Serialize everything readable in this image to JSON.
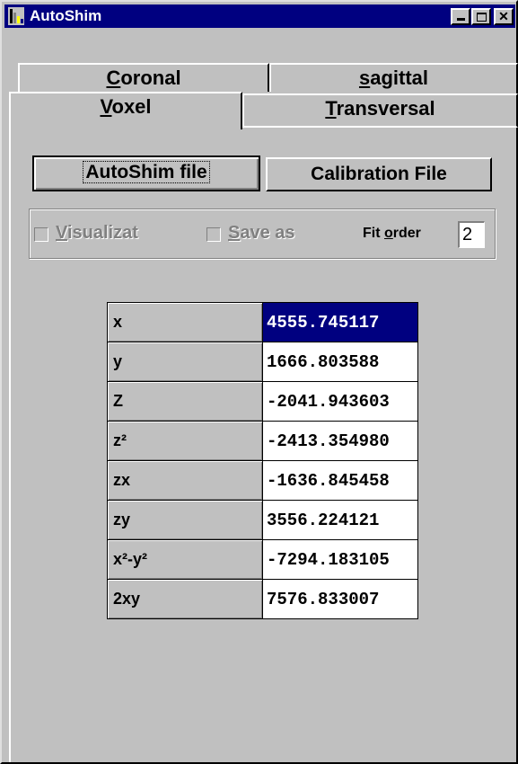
{
  "window": {
    "title": "AutoShim"
  },
  "tabs": {
    "row_back": [
      {
        "label_pre": "",
        "label_u": "C",
        "label_post": "oronal"
      },
      {
        "label_pre": "",
        "label_u": "s",
        "label_post": "agittal"
      }
    ],
    "row_front": [
      {
        "label_pre": "",
        "label_u": "V",
        "label_post": "oxel"
      },
      {
        "label_pre": "",
        "label_u": "T",
        "label_post": "ransversal"
      }
    ]
  },
  "buttons": {
    "autoshim_file": "AutoShim file",
    "calibration_file": "Calibration File"
  },
  "options": {
    "visualize_label_u": "V",
    "visualize_label_rest": "isualizat",
    "save_label_u": "S",
    "save_label_rest": "ave as",
    "fit_order_pre": "Fit ",
    "fit_order_u": "o",
    "fit_order_post": "rder",
    "fit_order_value": "2"
  },
  "grid": {
    "rows": [
      {
        "label": "x",
        "value": "4555.745117"
      },
      {
        "label": "y",
        "value": "1666.803588"
      },
      {
        "label": "Z",
        "value": "-2041.943603"
      },
      {
        "label": "z²",
        "value": "-2413.354980"
      },
      {
        "label": "zx",
        "value": "-1636.845458"
      },
      {
        "label": "zy",
        "value": "3556.224121"
      },
      {
        "label": "x²-y²",
        "value": "-7294.183105"
      },
      {
        "label": "2xy",
        "value": "7576.833007"
      }
    ],
    "selected_row": 0
  },
  "colors": {
    "titlebar": "#000080",
    "face": "#c0c0c0",
    "selection": "#000080"
  }
}
